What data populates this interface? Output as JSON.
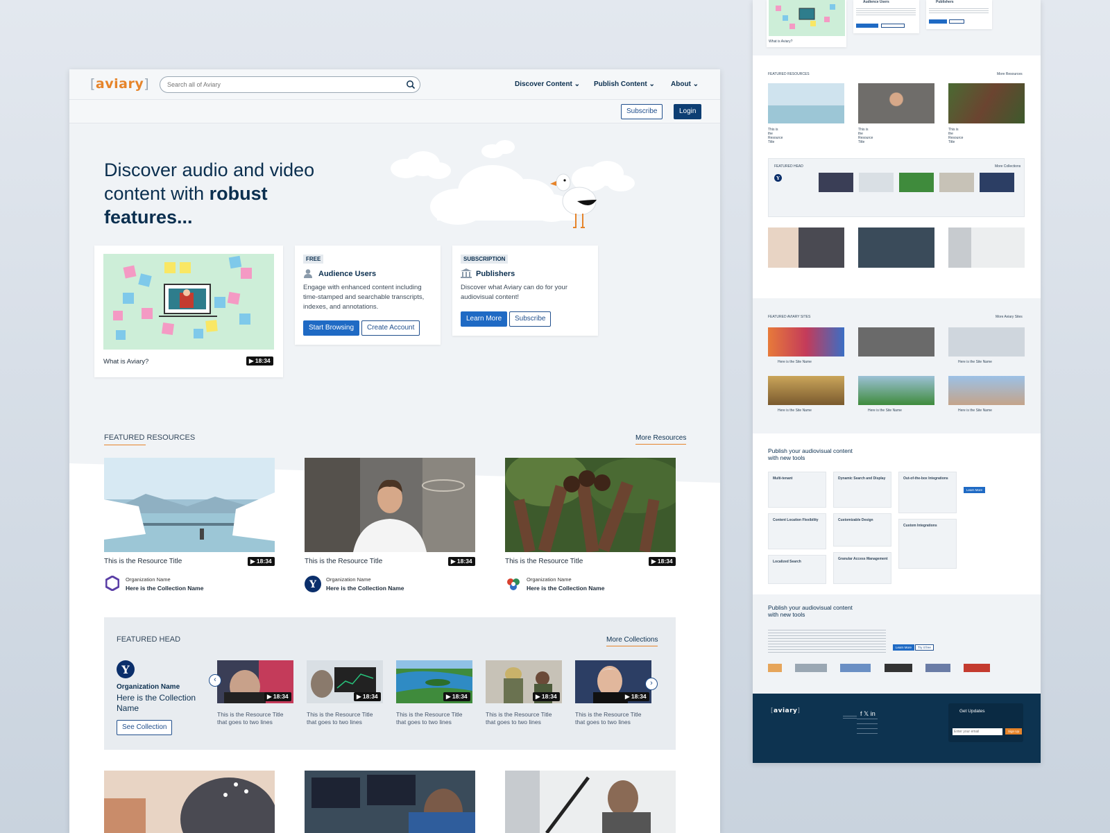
{
  "header": {
    "logo": "aviary",
    "search_placeholder": "Search all of Aviary",
    "nav": [
      "Discover Content",
      "Publish Content",
      "About"
    ],
    "subscribe": "Subscribe",
    "login": "Login"
  },
  "hero": {
    "title_line1": "Discover audio and video",
    "title_line2a": "content with ",
    "title_line2b": "robust",
    "title_line3": "features...",
    "video_title": "What is Aviary?",
    "video_duration": "18:34"
  },
  "audience": {
    "tag": "FREE",
    "title": "Audience Users",
    "desc": "Engage with enhanced content including time-stamped and searchable transcripts, indexes, and annotations.",
    "primary": "Start Browsing",
    "secondary": "Create Account"
  },
  "publishers": {
    "tag": "SUBSCRIPTION",
    "title": "Publishers",
    "desc": "Discover what Aviary can do for your audiovisual content!",
    "primary": "Learn More",
    "secondary": "Subscribe"
  },
  "featured_resources": {
    "heading": "FEATURED RESOURCES",
    "more": "More Resources",
    "items": [
      {
        "title": "This is the Resource Title",
        "duration": "18:34",
        "org": "Organization Name",
        "collection": "Here is the Collection Name"
      },
      {
        "title": "This is the Resource Title",
        "duration": "18:34",
        "org": "Organization Name",
        "collection": "Here is the Collection Name"
      },
      {
        "title": "This is the Resource Title",
        "duration": "18:34",
        "org": "Organization Name",
        "collection": "Here is the Collection Name"
      }
    ]
  },
  "featured_head": {
    "heading": "FEATURED HEAD",
    "more": "More Collections",
    "org": "Organization Name",
    "collection": "Here is the Collection Name",
    "see": "See Collection",
    "items": [
      {
        "title": "This is the Resource Title that goes to two lines",
        "duration": "18:34"
      },
      {
        "title": "This is the Resource Title that goes to two lines",
        "duration": "18:34"
      },
      {
        "title": "This is the Resource Title that goes to two lines",
        "duration": "18:34"
      },
      {
        "title": "This is the Resource Title that goes to two lines",
        "duration": "18:34"
      },
      {
        "title": "This is the Resource Title that goes to two lines",
        "duration": "18:34"
      }
    ]
  },
  "side": {
    "audience_title": "Audience Users",
    "publishers_title": "Publishers",
    "what": "What is Aviary?",
    "featured_resources": "FEATURED RESOURCES",
    "more_resources": "More Resources",
    "resource_title": "This is the Resource Title",
    "featured_head": "FEATURED HEAD",
    "more_collections": "More Collections",
    "featured_sites": "FEATURED AVIARY SITES",
    "more_sites": "More Aviary Sites",
    "site_name": "Here is the Site Name",
    "publish_title": "Publish your audiovisual content with new tools",
    "tools": [
      "Multi-tenant",
      "Dynamic Search and Display",
      "Out-of-the-box Integrations",
      "Content Location Flexibility",
      "Customizable Design",
      "Custom Integrations",
      "Localized Search",
      "Granular Access Management"
    ],
    "learn_more": "Learn More",
    "try_free": "Try it free",
    "get_updates": "Get Updates",
    "sign_up": "Sign Up",
    "email_placeholder": "Enter your email"
  },
  "colors": {
    "brand_orange": "#e6842a",
    "navy": "#0b2f4f",
    "primary_blue": "#1f6ac4",
    "footer": "#0d3350"
  }
}
